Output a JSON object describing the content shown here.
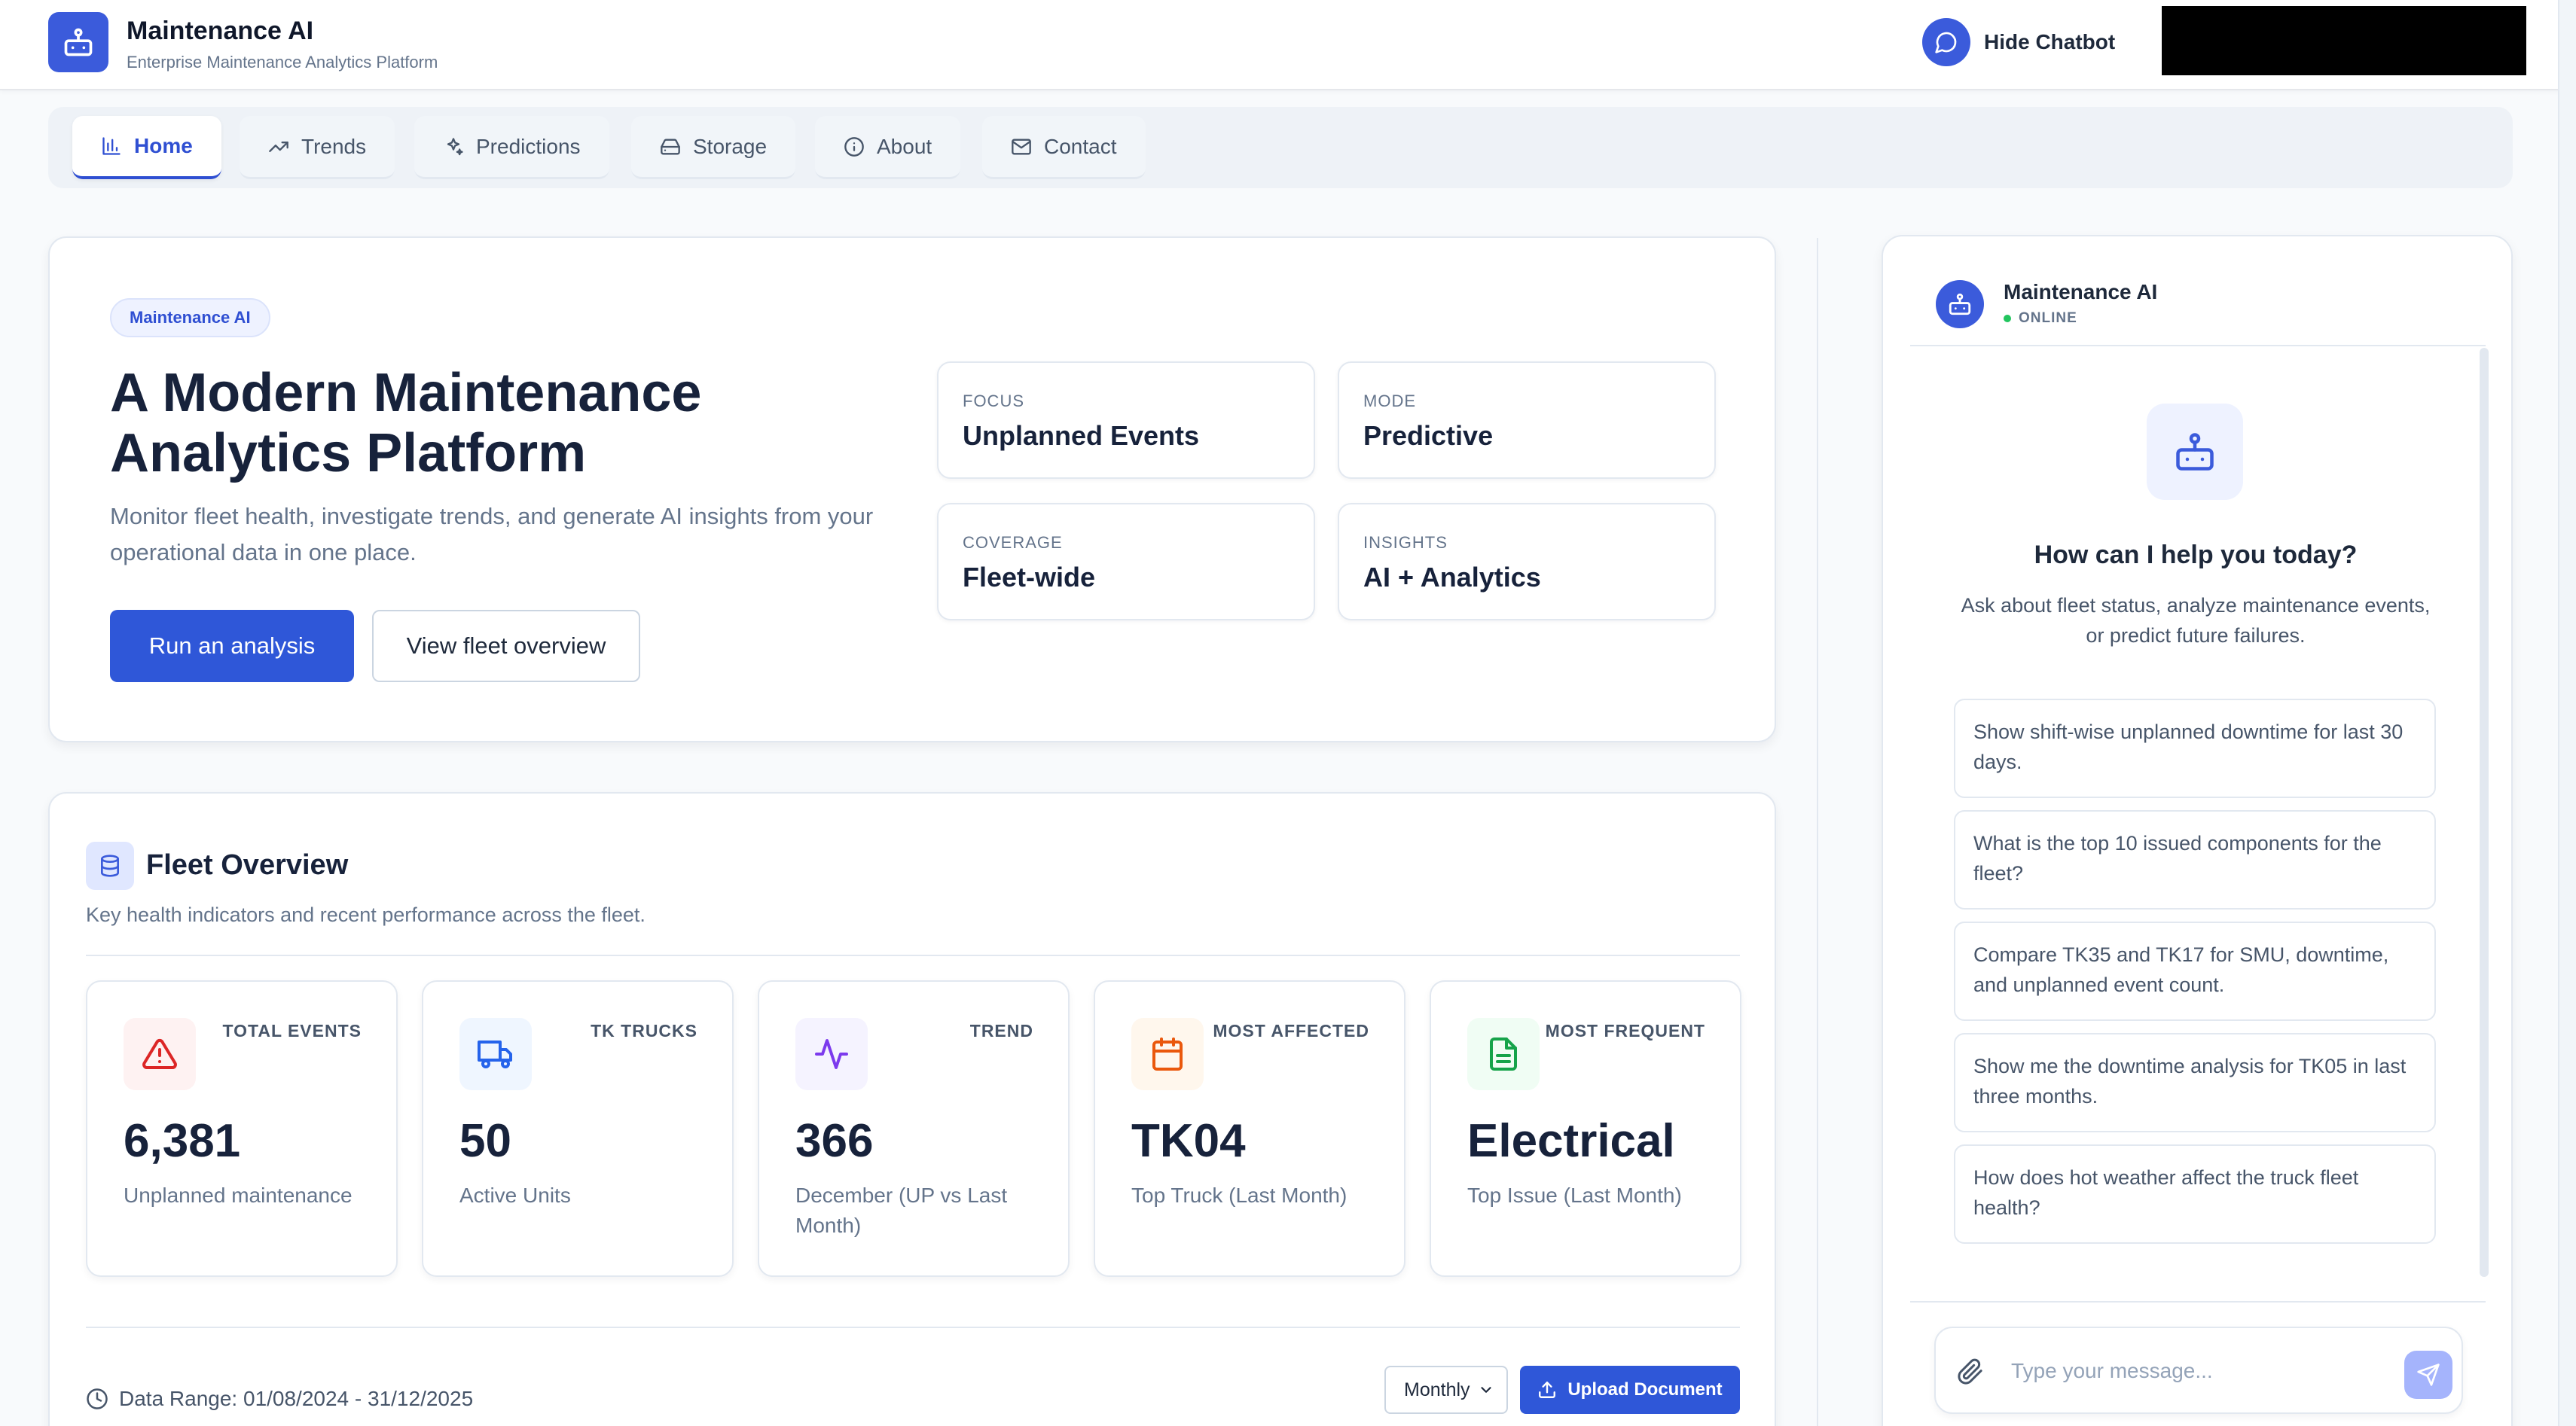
{
  "header": {
    "title": "Maintenance AI",
    "subtitle": "Enterprise Maintenance Analytics Platform",
    "hide_chatbot_label": "Hide Chatbot",
    "icon": "robot-icon"
  },
  "nav": {
    "tabs": [
      {
        "label": "Home",
        "icon": "bar-chart-icon",
        "active": true
      },
      {
        "label": "Trends",
        "icon": "trending-up-icon",
        "active": false
      },
      {
        "label": "Predictions",
        "icon": "sparkles-icon",
        "active": false
      },
      {
        "label": "Storage",
        "icon": "hard-drive-icon",
        "active": false
      },
      {
        "label": "About",
        "icon": "info-icon",
        "active": false
      },
      {
        "label": "Contact",
        "icon": "mail-icon",
        "active": false
      }
    ]
  },
  "hero": {
    "badge": "Maintenance AI",
    "title": "A Modern Maintenance Analytics Platform",
    "description": "Monitor fleet health, investigate trends, and generate AI insights from your operational data in one place.",
    "primary_button": "Run an analysis",
    "secondary_button": "View fleet overview",
    "stats": [
      {
        "key": "FOCUS",
        "value": "Unplanned Events"
      },
      {
        "key": "MODE",
        "value": "Predictive"
      },
      {
        "key": "COVERAGE",
        "value": "Fleet-wide"
      },
      {
        "key": "INSIGHTS",
        "value": "AI + Analytics"
      }
    ]
  },
  "fleet": {
    "title": "Fleet Overview",
    "subtitle": "Key health indicators and recent performance across the fleet.",
    "icon": "database-icon",
    "metrics": [
      {
        "label": "TOTAL EVENTS",
        "value": "6,381",
        "desc": "Unplanned maintenance",
        "icon": "alert-triangle-icon",
        "color": "#dc2626",
        "bg": "#fef2f2"
      },
      {
        "label": "TK TRUCKS",
        "value": "50",
        "desc": "Active Units",
        "icon": "truck-icon",
        "color": "#2563eb",
        "bg": "#eff6ff"
      },
      {
        "label": "TREND",
        "value": "366",
        "desc": "December (UP vs Last Month)",
        "icon": "activity-icon",
        "color": "#7c3aed",
        "bg": "#f5f3ff"
      },
      {
        "label": "MOST AFFECTED",
        "value": "TK04",
        "desc": "Top Truck (Last Month)",
        "icon": "calendar-icon",
        "color": "#ea580c",
        "bg": "#fff7ed"
      },
      {
        "label": "MOST FREQUENT",
        "value": "Electrical",
        "desc": "Top Issue (Last Month)",
        "icon": "file-text-icon",
        "color": "#16a34a",
        "bg": "#f0fdf4"
      }
    ],
    "data_range": "Data Range: 01/08/2024 - 31/12/2025",
    "period_select": "Monthly",
    "upload_label": "Upload Document"
  },
  "chat": {
    "name": "Maintenance AI",
    "status": "ONLINE",
    "heading": "How can I help you today?",
    "intro": "Ask about fleet status, analyze maintenance events, or predict future failures.",
    "suggestions": [
      "Show shift-wise unplanned downtime for last 30 days.",
      "What is the top 10 issued components for the fleet?",
      "Compare TK35 and TK17 for SMU, downtime, and unplanned event count.",
      "Show me the downtime analysis for TK05 in last three months.",
      "How does hot weather affect the truck fleet health?"
    ],
    "input_placeholder": "Type your message..."
  },
  "colors": {
    "accent": "#2f57d8",
    "brand": "#3b5bdb",
    "online": "#22c55e"
  }
}
